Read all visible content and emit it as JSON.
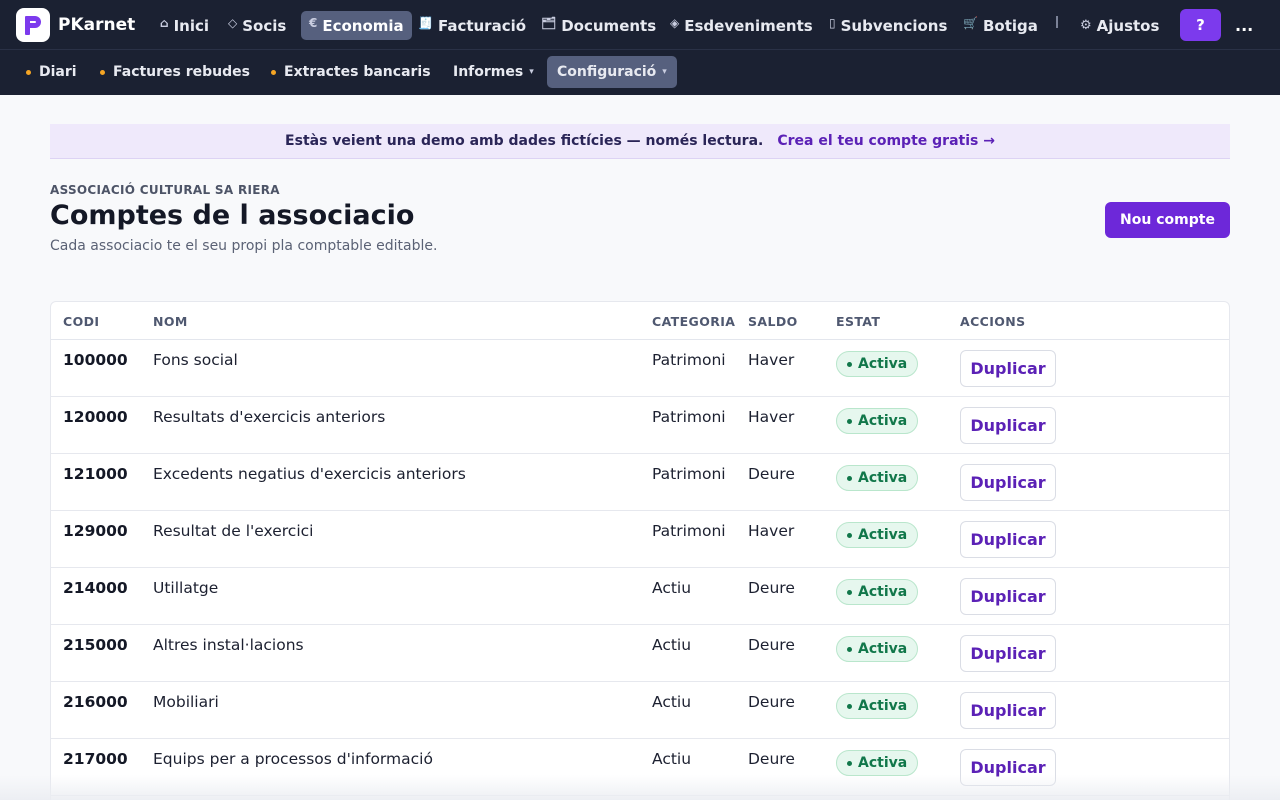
{
  "app": {
    "name": "PKarnet"
  },
  "topnav": {
    "items": [
      {
        "icon": "⌂",
        "label": "Inici"
      },
      {
        "icon": "◇",
        "label": "Socis"
      },
      {
        "icon": "€",
        "label": "Economia"
      },
      {
        "icon": "🧾",
        "label": "Facturació"
      },
      {
        "icon": "🗂",
        "label": "Documents"
      },
      {
        "icon": "◈",
        "label": "Esdeveniments"
      },
      {
        "icon": "▯",
        "label": "Subvencions"
      },
      {
        "icon": "🛒",
        "label": "Botiga"
      }
    ],
    "settings": {
      "icon": "⚙",
      "label": "Ajustos"
    },
    "help_label": "?",
    "more_label": "..."
  },
  "subnav": {
    "items": [
      {
        "label": "Diari"
      },
      {
        "label": "Factures rebudes"
      },
      {
        "label": "Extractes bancaris"
      },
      {
        "label": "Informes"
      },
      {
        "label": "Configuració"
      }
    ]
  },
  "banner": {
    "message": "Estàs veient una demo amb dades fictícies — només lectura.",
    "cta": "Crea el teu compte gratis →"
  },
  "header": {
    "org": "ASSOCIACIÓ CULTURAL SA RIERA",
    "title": "Comptes de l associacio",
    "subtitle": "Cada associacio te el seu propi pla comptable editable.",
    "new_button": "Nou compte"
  },
  "table": {
    "columns": [
      "CODI",
      "NOM",
      "CATEGORIA",
      "SALDO",
      "ESTAT",
      "ACCIONS"
    ],
    "rows": [
      {
        "code": "100000",
        "name": "Fons social",
        "category": "Patrimoni",
        "balance": "Haver",
        "status": "Activa",
        "action": "Duplicar"
      },
      {
        "code": "120000",
        "name": "Resultats d'exercicis anteriors",
        "category": "Patrimoni",
        "balance": "Haver",
        "status": "Activa",
        "action": "Duplicar"
      },
      {
        "code": "121000",
        "name": "Excedents negatius d'exercicis anteriors",
        "category": "Patrimoni",
        "balance": "Deure",
        "status": "Activa",
        "action": "Duplicar"
      },
      {
        "code": "129000",
        "name": "Resultat de l'exercici",
        "category": "Patrimoni",
        "balance": "Haver",
        "status": "Activa",
        "action": "Duplicar"
      },
      {
        "code": "214000",
        "name": "Utillatge",
        "category": "Actiu",
        "balance": "Deure",
        "status": "Activa",
        "action": "Duplicar"
      },
      {
        "code": "215000",
        "name": "Altres instal·lacions",
        "category": "Actiu",
        "balance": "Deure",
        "status": "Activa",
        "action": "Duplicar"
      },
      {
        "code": "216000",
        "name": "Mobiliari",
        "category": "Actiu",
        "balance": "Deure",
        "status": "Activa",
        "action": "Duplicar"
      },
      {
        "code": "217000",
        "name": "Equips per a processos d'informació",
        "category": "Actiu",
        "balance": "Deure",
        "status": "Activa",
        "action": "Duplicar"
      }
    ]
  },
  "colors": {
    "nav_bg": "#1b2132",
    "accent": "#6d28d9",
    "status_active": "#11774a"
  }
}
